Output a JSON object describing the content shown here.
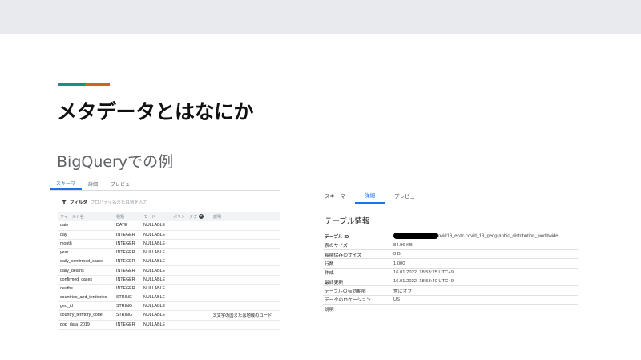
{
  "slide": {
    "title": "メタデータとはなにか",
    "subtitle": "BigQueryでの例",
    "accent_colors": [
      "#1a8f82",
      "#d8611e"
    ]
  },
  "schema_panel": {
    "tabs": [
      {
        "label": "スキーマ",
        "active": true
      },
      {
        "label": "詳細",
        "active": false
      },
      {
        "label": "プレビュー",
        "active": false
      }
    ],
    "filter": {
      "label": "フィルタ",
      "placeholder": "プロパティ名または値を入力"
    },
    "columns": [
      "フィールド名",
      "種類",
      "モード",
      "ポリシータグ",
      "説明"
    ],
    "rows": [
      {
        "name": "date",
        "type": "DATE",
        "mode": "NULLABLE",
        "desc": ""
      },
      {
        "name": "day",
        "type": "INTEGER",
        "mode": "NULLABLE",
        "desc": ""
      },
      {
        "name": "month",
        "type": "INTEGER",
        "mode": "NULLABLE",
        "desc": ""
      },
      {
        "name": "year",
        "type": "INTEGER",
        "mode": "NULLABLE",
        "desc": ""
      },
      {
        "name": "daily_confirmed_cases",
        "type": "INTEGER",
        "mode": "NULLABLE",
        "desc": ""
      },
      {
        "name": "daily_deaths",
        "type": "INTEGER",
        "mode": "NULLABLE",
        "desc": ""
      },
      {
        "name": "confirmed_cases",
        "type": "INTEGER",
        "mode": "NULLABLE",
        "desc": ""
      },
      {
        "name": "deaths",
        "type": "INTEGER",
        "mode": "NULLABLE",
        "desc": ""
      },
      {
        "name": "countries_and_territories",
        "type": "STRING",
        "mode": "NULLABLE",
        "desc": ""
      },
      {
        "name": "geo_id",
        "type": "STRING",
        "mode": "NULLABLE",
        "desc": ""
      },
      {
        "name": "country_territory_code",
        "type": "STRING",
        "mode": "NULLABLE",
        "desc": "3 文字の国または地域のコード"
      },
      {
        "name": "pop_data_2019",
        "type": "INTEGER",
        "mode": "NULLABLE",
        "desc": ""
      }
    ]
  },
  "details_panel": {
    "tabs": [
      {
        "label": "スキーマ",
        "active": false
      },
      {
        "label": "詳細",
        "active": true
      },
      {
        "label": "プレビュー",
        "active": false
      }
    ],
    "title": "テーブル情報",
    "rows": [
      {
        "label": "テーブル ID",
        "value": "ovid19_ecdc.covid_19_geographic_distribution_worldwide",
        "redacted_prefix": true
      },
      {
        "label": "表のサイズ",
        "value": "84.96 KB"
      },
      {
        "label": "長期保存のサイズ",
        "value": "0 B"
      },
      {
        "label": "行数",
        "value": "1,000"
      },
      {
        "label": "作成",
        "value": "16.01.2022, 18:53:25 UTC+9"
      },
      {
        "label": "最終更新",
        "value": "16.01.2022, 18:53:40 UTC+9"
      },
      {
        "label": "テーブルの有効期限",
        "value": "常にオフ"
      },
      {
        "label": "データのロケーション",
        "value": "US"
      },
      {
        "label": "説明",
        "value": ""
      }
    ]
  }
}
